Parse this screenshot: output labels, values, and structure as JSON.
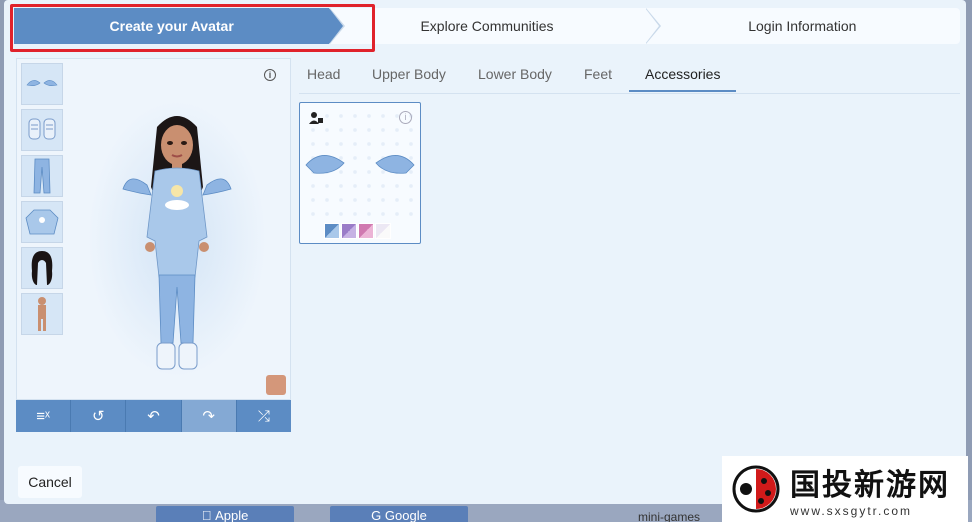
{
  "wizard": {
    "steps": [
      {
        "label": "Create your Avatar"
      },
      {
        "label": "Explore Communities"
      },
      {
        "label": "Login Information"
      }
    ]
  },
  "preview": {
    "thumbnails": [
      "wings-icon",
      "sneakers-icon",
      "jeans-icon",
      "hoodie-icon",
      "hair-icon",
      "body-icon"
    ],
    "skin_color": "#d4977a"
  },
  "toolbar": {
    "tools": [
      "clear-all-icon",
      "undo-all-icon",
      "undo-icon",
      "redo-icon",
      "shuffle-icon"
    ]
  },
  "tabs": [
    {
      "label": "Head"
    },
    {
      "label": "Upper Body"
    },
    {
      "label": "Lower Body"
    },
    {
      "label": "Feet"
    },
    {
      "label": "Accessories"
    }
  ],
  "card": {
    "swatch_colors": [
      "#5c8cc4",
      "#9a7cc8",
      "#d079b0",
      "#ece8f4"
    ]
  },
  "footer": {
    "cancel_label": "Cancel"
  },
  "background": {
    "apple_label": "Apple",
    "google_label": "Google",
    "minigames_label": "mini-games"
  },
  "watermark": {
    "main": "国投新游网",
    "sub": "www.sxsgytr.com"
  },
  "colors": {
    "accent": "#5c8cc4",
    "highlight": "#e0222b"
  }
}
